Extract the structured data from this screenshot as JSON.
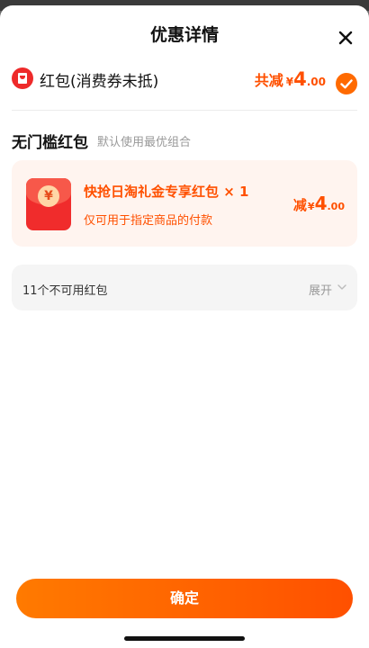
{
  "header": {
    "title": "优惠详情"
  },
  "red_packet": {
    "label": "红包(消费券未抵)",
    "total_label": "共减",
    "currency": "¥",
    "total_int": "4",
    "total_dec": ".00",
    "selected": true
  },
  "section": {
    "title": "无门槛红包",
    "subtitle": "默认使用最优组合"
  },
  "coupon": {
    "name": "快抢日淘礼金专享红包 × 1",
    "desc": "仅可用于指定商品的付款",
    "amount_label": "减",
    "currency": "¥",
    "amount_int": "4",
    "amount_dec": ".00",
    "symbol": "¥"
  },
  "unavailable": {
    "label": "11个不可用红包",
    "expand": "展开"
  },
  "footer": {
    "confirm": "确定"
  },
  "colors": {
    "accent": "#ff5000",
    "coupon_bg": "#fff4ef",
    "envelope": "#f02c2c"
  }
}
